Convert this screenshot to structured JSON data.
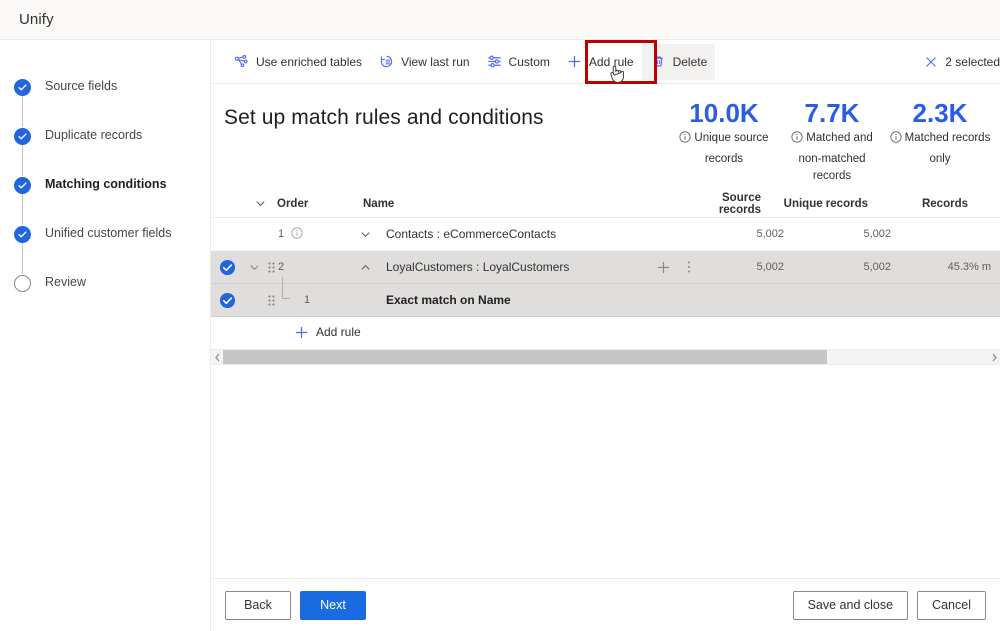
{
  "header": {
    "title": "Unify"
  },
  "sidebar": {
    "items": [
      {
        "label": "Source fields",
        "state": "done"
      },
      {
        "label": "Duplicate records",
        "state": "done"
      },
      {
        "label": "Matching conditions",
        "state": "current"
      },
      {
        "label": "Unified customer fields",
        "state": "done"
      },
      {
        "label": "Review",
        "state": "todo"
      }
    ]
  },
  "toolbar": {
    "buttons": [
      {
        "label": "Use enriched tables",
        "icon": "enriched-tables-icon"
      },
      {
        "label": "View last run",
        "icon": "history-icon"
      },
      {
        "label": "Custom",
        "icon": "sliders-icon"
      },
      {
        "label": "Add rule",
        "icon": "plus-icon"
      },
      {
        "label": "Delete",
        "icon": "trash-icon"
      }
    ],
    "selection_label": "2 selected",
    "selection_icon": "close-icon",
    "highlight_color": "#c00000"
  },
  "main": {
    "page_title": "Set up match rules and conditions",
    "kpis": [
      {
        "value": "10.0K",
        "caption_line1": "Unique source",
        "caption_line2": "records"
      },
      {
        "value": "7.7K",
        "caption_line1": "Matched and",
        "caption_line2": "non-matched records"
      },
      {
        "value": "2.3K",
        "caption_line1": "Matched records",
        "caption_line2": "only"
      }
    ],
    "kpi_color": "#2b5ce6",
    "table": {
      "columns": {
        "order": "Order",
        "name": "Name",
        "source_records": "Source records",
        "unique_records": "Unique records",
        "records": "Records"
      },
      "rows": [
        {
          "selected": false,
          "order": "1",
          "name": "Contacts : eCommerceContacts",
          "source_records": "5,002",
          "unique_records": "5,002",
          "records": ""
        },
        {
          "selected": true,
          "order": "2",
          "name": "LoyalCustomers : LoyalCustomers",
          "source_records": "5,002",
          "unique_records": "5,002",
          "records": "45.3% m"
        }
      ],
      "subrow": {
        "selected": true,
        "order": "1",
        "name": "Exact match on Name"
      },
      "add_rule_label": "Add rule"
    }
  },
  "footer": {
    "back_label": "Back",
    "next_label": "Next",
    "save_label": "Save and close",
    "cancel_label": "Cancel"
  }
}
